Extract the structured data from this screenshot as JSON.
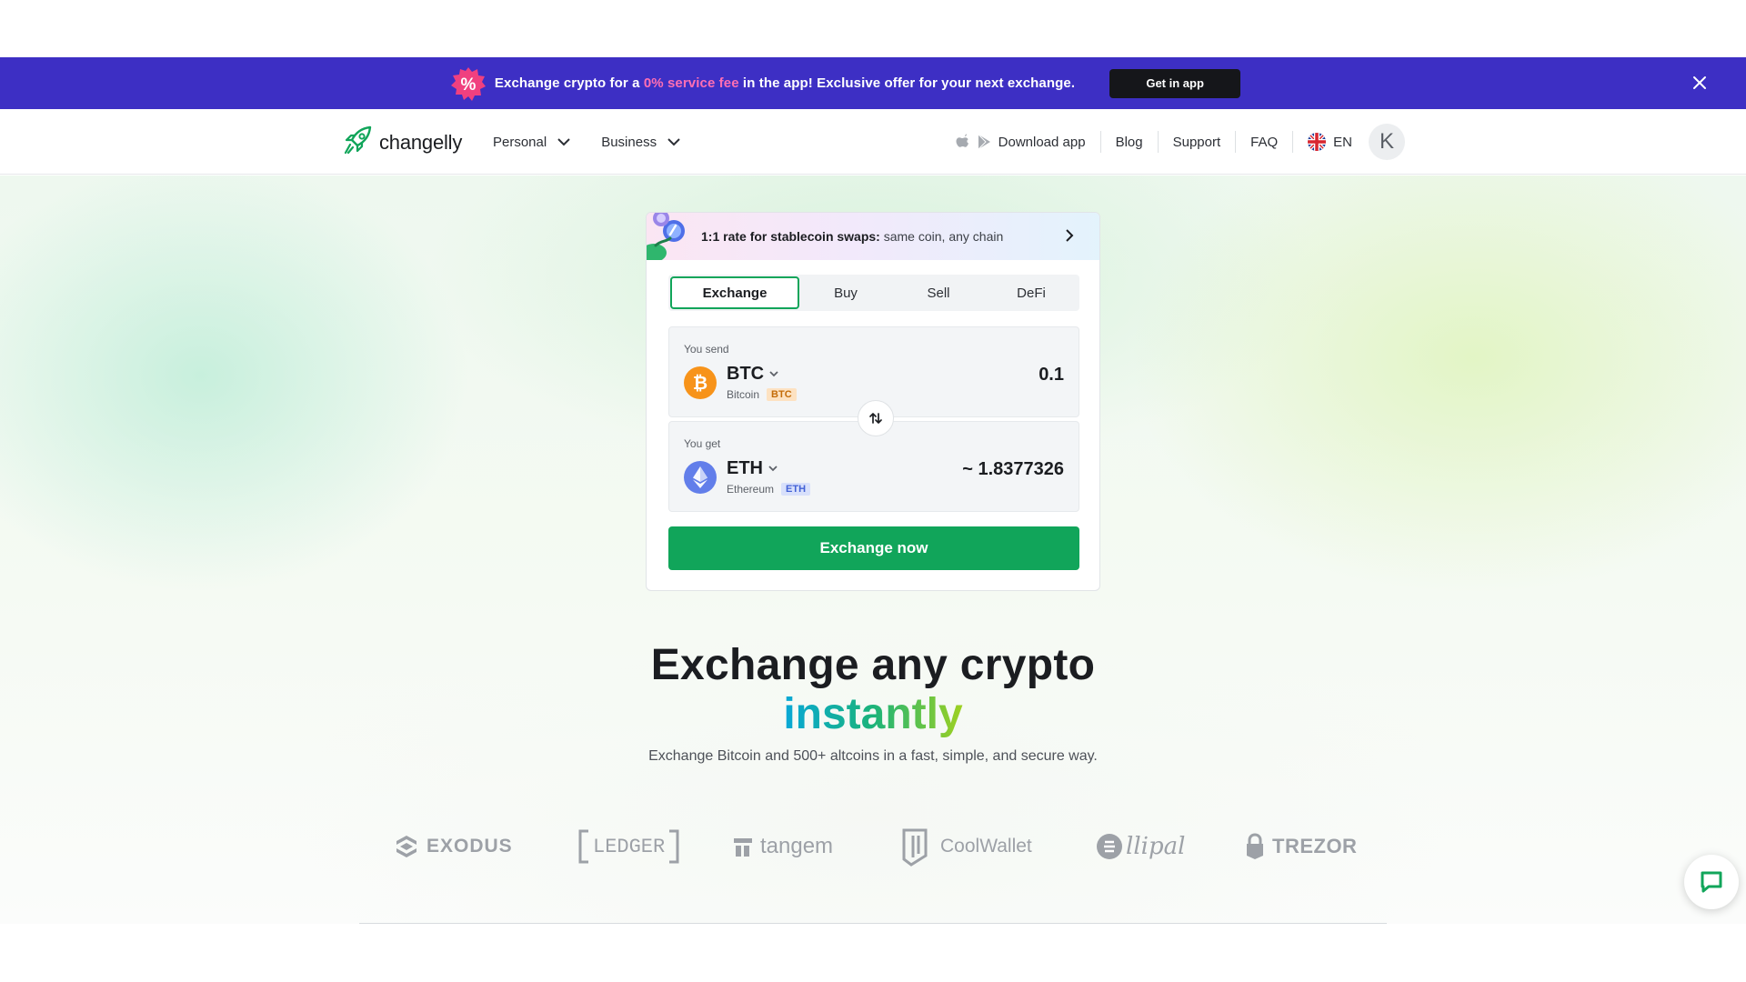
{
  "promo_banner": {
    "badge_symbol": "%",
    "text_before": "Exchange crypto for a",
    "highlight": "0% service fee",
    "text_after": "in the app! Exclusive offer for your next exchange.",
    "button_label": "Get in app",
    "colors": {
      "background": "#3d2fc4",
      "highlight": "#ff6fb3",
      "badge": "#f0407f"
    }
  },
  "header": {
    "logo_text": "changelly",
    "nav_left": [
      {
        "label": "Personal"
      },
      {
        "label": "Business"
      }
    ],
    "nav_right": {
      "download_label": "Download app",
      "blog_label": "Blog",
      "support_label": "Support",
      "faq_label": "FAQ",
      "language": "EN",
      "avatar_initial": "K"
    }
  },
  "widget": {
    "strip": {
      "bold": "1:1 rate for stablecoin swaps:",
      "rest": "same coin, any chain"
    },
    "tabs": [
      {
        "label": "Exchange",
        "active": true
      },
      {
        "label": "Buy",
        "active": false
      },
      {
        "label": "Sell",
        "active": false
      },
      {
        "label": "DeFi",
        "active": false
      }
    ],
    "send": {
      "label": "You send",
      "ticker": "BTC",
      "name": "Bitcoin",
      "tag": "BTC",
      "amount": "0.1",
      "icon": "bitcoin-icon",
      "color": "#f7931a"
    },
    "get": {
      "label": "You get",
      "ticker": "ETH",
      "name": "Ethereum",
      "tag": "ETH",
      "amount": "~ 1.8377326",
      "icon": "ethereum-icon",
      "color": "#627eea"
    },
    "button_label": "Exchange now",
    "accent": "#11a55a"
  },
  "hero": {
    "title_line1": "Exchange any crypto",
    "title_line2": "instantly",
    "subtitle": "Exchange Bitcoin and 500+ altcoins in a fast, simple, and secure way."
  },
  "partners": [
    {
      "name": "EXODUS"
    },
    {
      "name": "LEDGER"
    },
    {
      "name": "tangem"
    },
    {
      "name": "CoolWallet"
    },
    {
      "name": "llipal"
    },
    {
      "name": "TREZOR"
    }
  ]
}
